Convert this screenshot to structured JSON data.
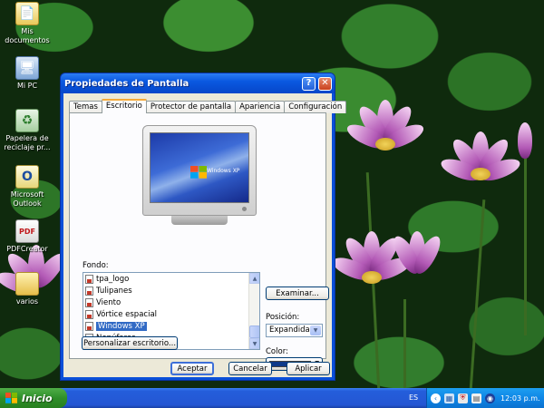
{
  "desktop": {
    "icons": [
      {
        "label": "Mis documentos",
        "icon": "folder-documents-icon"
      },
      {
        "label": "Mi PC",
        "icon": "my-computer-icon"
      },
      {
        "label": "Papelera de reciclaje pr...",
        "icon": "recycle-bin-icon"
      },
      {
        "label": "Microsoft Outlook",
        "icon": "outlook-icon"
      },
      {
        "label": "PDFCreator",
        "icon": "pdf-creator-icon"
      },
      {
        "label": "varios",
        "icon": "folder-icon"
      }
    ]
  },
  "window": {
    "title": "Propiedades de Pantalla",
    "help_glyph": "?",
    "close_glyph": "✕",
    "tabs": [
      {
        "label": "Temas",
        "active": false
      },
      {
        "label": "Escritorio",
        "active": true
      },
      {
        "label": "Protector de pantalla",
        "active": false
      },
      {
        "label": "Apariencia",
        "active": false
      },
      {
        "label": "Configuración",
        "active": false
      }
    ],
    "preview_logo_text": "Windows XP",
    "fondo_label": "Fondo:",
    "backgrounds": [
      {
        "label": "tpa_logo",
        "selected": false
      },
      {
        "label": "Tulipanes",
        "selected": false
      },
      {
        "label": "Viento",
        "selected": false
      },
      {
        "label": "Vórtice espacial",
        "selected": false
      },
      {
        "label": "Windows XP",
        "selected": true
      },
      {
        "label": "Nenúfares",
        "selected": false
      }
    ],
    "browse_label": "Examinar...",
    "position_label": "Posición:",
    "position_value": "Expandida",
    "color_label": "Color:",
    "color_value": "#0e3a8a",
    "customize_label": "Personalizar escritorio...",
    "ok_label": "Aceptar",
    "cancel_label": "Cancelar",
    "apply_label": "Aplicar"
  },
  "taskbar": {
    "start_label": "Inicio",
    "language": "ES",
    "clock": "12:03 p.m."
  }
}
